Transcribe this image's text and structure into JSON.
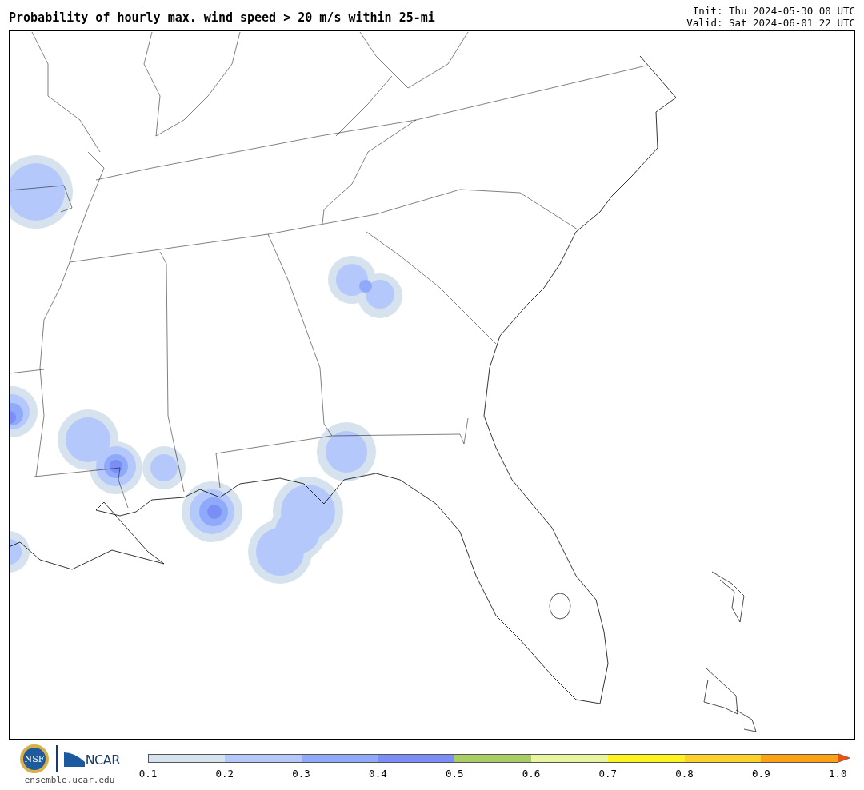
{
  "title": "Probability of hourly max. wind speed > 20 m/s within 25-mi",
  "init": "Init: Thu 2024-05-30 00 UTC",
  "valid": "Valid: Sat 2024-06-01 22 UTC",
  "logos": {
    "seal": "NSF",
    "wordmark": "NCAR",
    "site": "ensemble.ucar.edu"
  },
  "colorbar": {
    "bins": [
      {
        "kind": "block",
        "color": "#d6e2ee"
      },
      {
        "kind": "block",
        "color": "#b4c8fc"
      },
      {
        "kind": "block",
        "color": "#8faafa"
      },
      {
        "kind": "block",
        "color": "#7b8ef5"
      },
      {
        "kind": "block",
        "color": "#a8cd64"
      },
      {
        "kind": "block",
        "color": "#e8f4a0"
      },
      {
        "kind": "block",
        "color": "#fef31c"
      },
      {
        "kind": "block",
        "color": "#fed02a"
      },
      {
        "kind": "block",
        "color": "#fca214"
      },
      {
        "kind": "arrow",
        "color": "#f05010"
      }
    ],
    "ticks": [
      "0.1",
      "0.2",
      "0.3",
      "0.4",
      "0.5",
      "0.6",
      "0.7",
      "0.8",
      "0.9",
      "1.0"
    ]
  }
}
